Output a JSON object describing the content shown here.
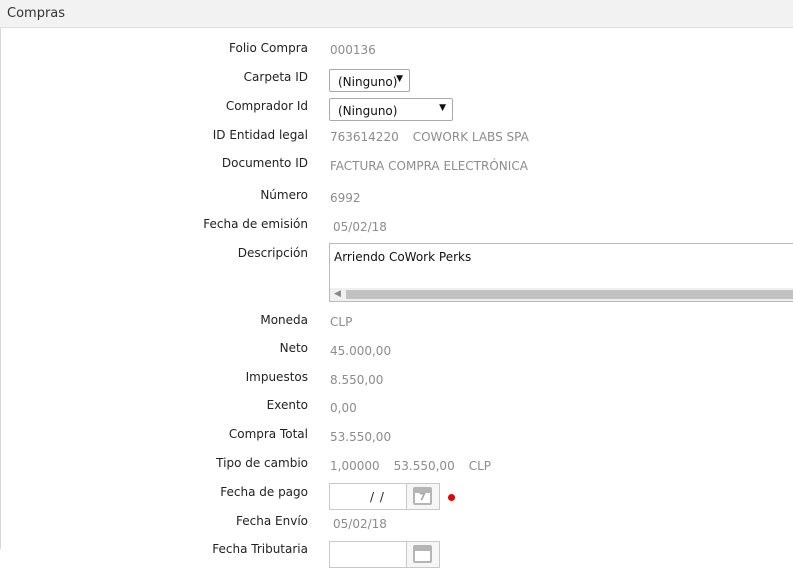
{
  "header": {
    "title": "Compras"
  },
  "form": {
    "folio_compra": {
      "label": "Folio Compra",
      "value": "000136"
    },
    "carpeta_id": {
      "label": "Carpeta ID",
      "selected": "(Ninguno)"
    },
    "comprador_id": {
      "label": "Comprador Id",
      "selected": "(Ninguno)"
    },
    "id_entidad_legal": {
      "label": "ID Entidad legal",
      "rut": "763614220",
      "name": "COWORK LABS SPA"
    },
    "documento_id": {
      "label": "Documento ID",
      "value": "FACTURA COMPRA ELECTRÓNICA"
    },
    "numero": {
      "label": "Número",
      "value": "6992"
    },
    "fecha_emision": {
      "label": "Fecha de emisión",
      "value": "05/02/18"
    },
    "descripcion": {
      "label": "Descripción",
      "value": "Arriendo CoWork Perks"
    },
    "moneda": {
      "label": "Moneda",
      "value": "CLP"
    },
    "neto": {
      "label": "Neto",
      "value": "45.000,00"
    },
    "impuestos": {
      "label": "Impuestos",
      "value": "8.550,00"
    },
    "exento": {
      "label": "Exento",
      "value": "0,00"
    },
    "compra_total": {
      "label": "Compra Total",
      "value": "53.550,00"
    },
    "tipo_cambio": {
      "label": "Tipo de cambio",
      "rate": "1,00000",
      "amount": "53.550,00",
      "currency": "CLP"
    },
    "fecha_pago": {
      "label": "Fecha de pago",
      "value": "/  /",
      "calendar_day": "7"
    },
    "fecha_envio": {
      "label": "Fecha Envío",
      "value": "05/02/18"
    },
    "fecha_tributaria": {
      "label": "Fecha Tributaria"
    }
  },
  "colors": {
    "required_marker": "#e00000"
  },
  "icons": {
    "calendar": "calendar-icon",
    "dropdown": "chevron-down-icon"
  }
}
